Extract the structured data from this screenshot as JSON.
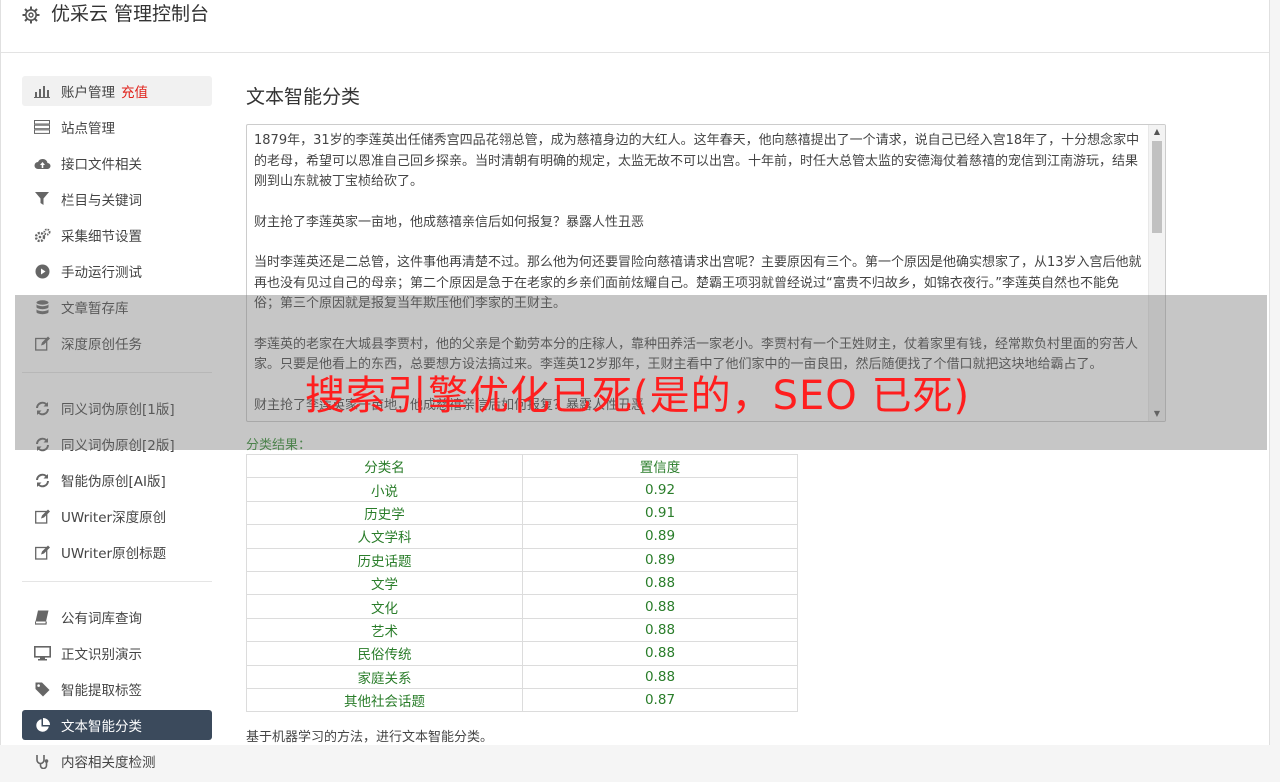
{
  "header": {
    "title": "优采云 管理控制台"
  },
  "sidebar": {
    "items": [
      {
        "label": "账户管理",
        "extra": "充值",
        "icon": "bar-chart-icon"
      },
      {
        "label": "站点管理",
        "icon": "server-icon"
      },
      {
        "label": "接口文件相关",
        "icon": "cloud-upload-icon"
      },
      {
        "label": "栏目与关键词",
        "icon": "filter-icon"
      },
      {
        "label": "采集细节设置",
        "icon": "gears-icon"
      },
      {
        "label": "手动运行测试",
        "icon": "play-circle-icon"
      },
      {
        "label": "文章暂存库",
        "icon": "database-icon"
      },
      {
        "label": "深度原创任务",
        "icon": "edit-icon"
      },
      {
        "label": "同义词伪原创[1版]",
        "icon": "refresh-icon"
      },
      {
        "label": "同义词伪原创[2版]",
        "icon": "refresh-icon"
      },
      {
        "label": "智能伪原创[AI版]",
        "icon": "refresh-icon"
      },
      {
        "label": "UWriter深度原创",
        "icon": "edit-icon"
      },
      {
        "label": "UWriter原创标题",
        "icon": "edit-icon"
      },
      {
        "label": "公有词库查询",
        "icon": "book-icon"
      },
      {
        "label": "正文识别演示",
        "icon": "monitor-icon"
      },
      {
        "label": "智能提取标签",
        "icon": "tag-icon"
      },
      {
        "label": "文本智能分类",
        "icon": "pie-chart-icon"
      },
      {
        "label": "内容相关度检测",
        "icon": "stethoscope-icon"
      }
    ]
  },
  "main": {
    "title": "文本智能分类",
    "paragraphs": [
      "1879年，31岁的李莲英出任储秀宫四品花翎总管，成为慈禧身边的大红人。这年春天，他向慈禧提出了一个请求，说自己已经入宫18年了，十分想念家中的老母，希望可以恩准自己回乡探亲。当时清朝有明确的规定，太监无故不可以出宫。十年前，时任大总管太监的安德海仗着慈禧的宠信到江南游玩，结果刚到山东就被丁宝桢给砍了。",
      "财主抢了李莲英家一亩地，他成慈禧亲信后如何报复？暴露人性丑恶",
      "当时李莲英还是二总管，这件事他再清楚不过。那么他为何还要冒险向慈禧请求出宫呢？主要原因有三个。第一个原因是他确实想家了，从13岁入宫后他就再也没有见过自己的母亲；第二个原因是急于在老家的乡亲们面前炫耀自己。楚霸王项羽就曾经说过“富贵不归故乡，如锦衣夜行。”李莲英自然也不能免俗；第三个原因就是报复当年欺压他们李家的王财主。",
      "李莲英的老家在大城县李贾村，他的父亲是个勤劳本分的庄稼人，靠种田养活一家老小。李贾村有一个王姓财主，仗着家里有钱，经常欺负村里面的穷苦人家。只要是他看上的东西，总要想方设法搞过来。李莲英12岁那年，王财主看中了他们家中的一亩良田，然后随便找了个借口就把这块地给霸占了。",
      "财主抢了李莲英家一亩地，他成慈禧亲信后如何报复？暴露人性丑恶"
    ],
    "result_label": "分类结果：",
    "table_headers": [
      "分类名",
      "置信度"
    ],
    "rows": [
      [
        "小说",
        "0.92"
      ],
      [
        "历史学",
        "0.91"
      ],
      [
        "人文学科",
        "0.89"
      ],
      [
        "历史话题",
        "0.89"
      ],
      [
        "文学",
        "0.88"
      ],
      [
        "文化",
        "0.88"
      ],
      [
        "艺术",
        "0.88"
      ],
      [
        "民俗传统",
        "0.88"
      ],
      [
        "家庭关系",
        "0.88"
      ],
      [
        "其他社会话题",
        "0.87"
      ]
    ],
    "note": "基于机器学习的方法，进行文本智能分类。"
  },
  "overlay": {
    "text": "搜索引擎优化已死(是的，SEO 已死)"
  },
  "colors": {
    "active_bg": "#3b4a5c",
    "recharge": "#e0211a",
    "result_green": "#2a7d2a",
    "overlay_text": "#ff1e1e"
  }
}
